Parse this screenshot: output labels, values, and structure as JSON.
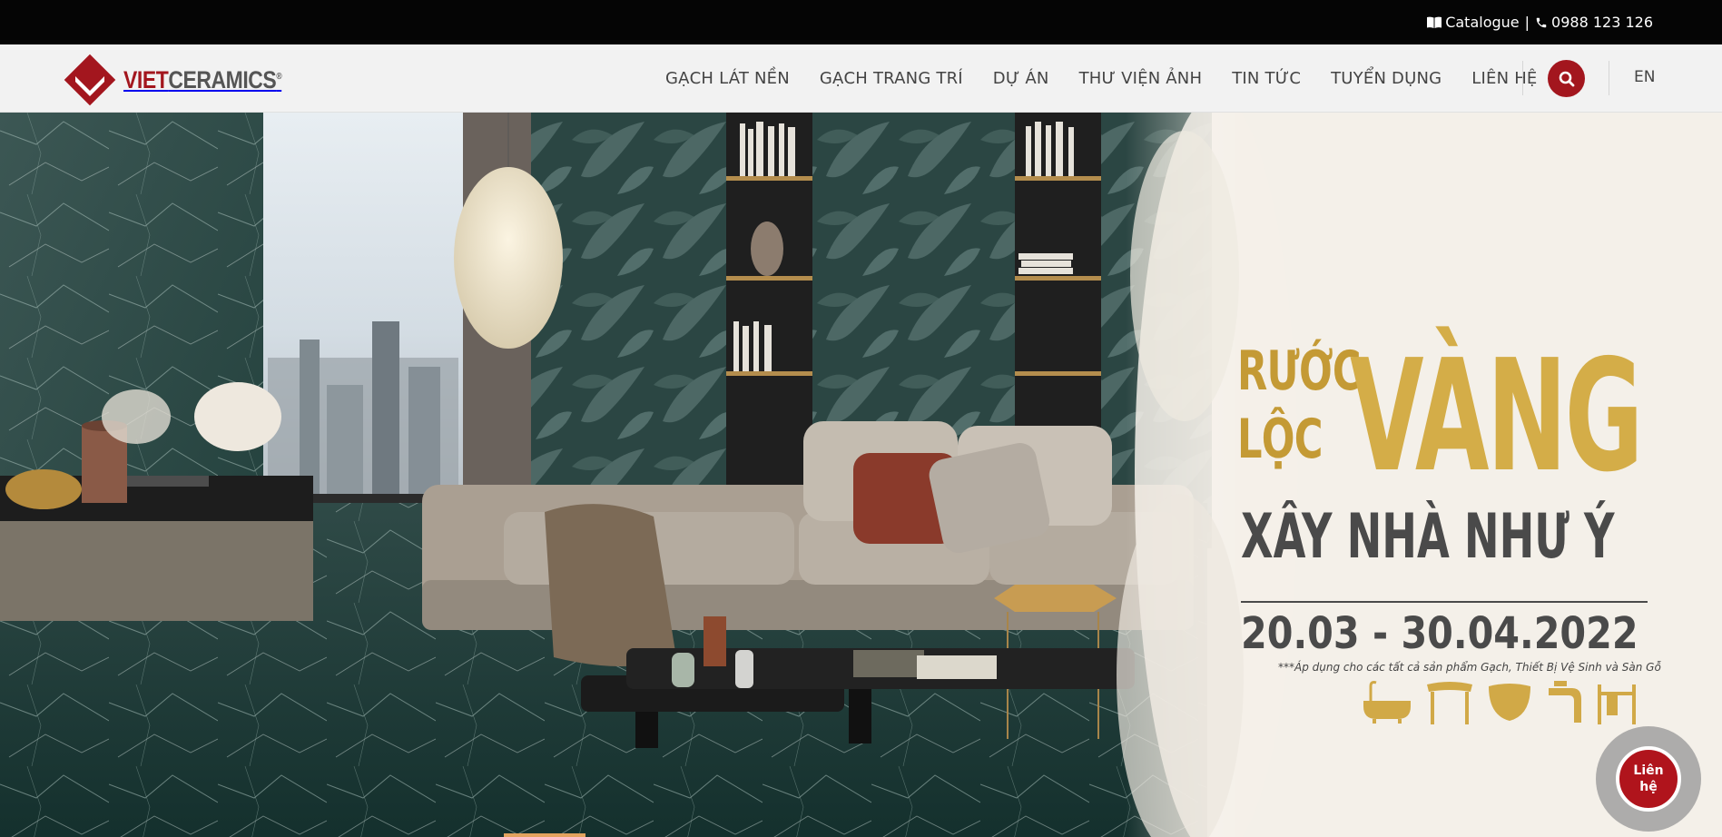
{
  "topbar": {
    "catalogue_label": "Catalogue",
    "separator": "|",
    "phone": "0988 123 126",
    "catalogue_icon": "book-icon",
    "phone_icon": "phone-icon"
  },
  "header": {
    "logo": {
      "part1": "VIET",
      "part2": "CERAMICS",
      "reg": "®"
    },
    "nav": [
      {
        "label": "GẠCH LÁT NỀN"
      },
      {
        "label": "GẠCH TRANG TRÍ"
      },
      {
        "label": "DỰ ÁN"
      },
      {
        "label": "THƯ VIỆN ẢNH"
      },
      {
        "label": "TIN TỨC"
      },
      {
        "label": "TUYỂN DỤNG"
      },
      {
        "label": "LIÊN HỆ"
      }
    ],
    "search_icon": "search-icon",
    "language": "EN"
  },
  "hero": {
    "line1a": "RƯỚC",
    "line1b": "LỘC",
    "big": "VÀNG",
    "sub": "XÂY NHÀ NHƯ Ý",
    "dates": "20.03 - 30.04.2022",
    "note": "***Áp dụng cho các tất cả sản phẩm Gạch, Thiết Bị Vệ Sinh và Sàn Gỗ",
    "icons": [
      "bathtub-icon",
      "sink-cabinet-icon",
      "toilet-icon",
      "faucet-icon",
      "towel-rack-icon"
    ]
  },
  "contact_button": {
    "line1": "Liên",
    "line2": "hệ"
  },
  "colors": {
    "brand_red": "#a3161e",
    "gold": "#d4ad48",
    "topbar": "#050505",
    "header_bg": "#f2f2f2"
  }
}
